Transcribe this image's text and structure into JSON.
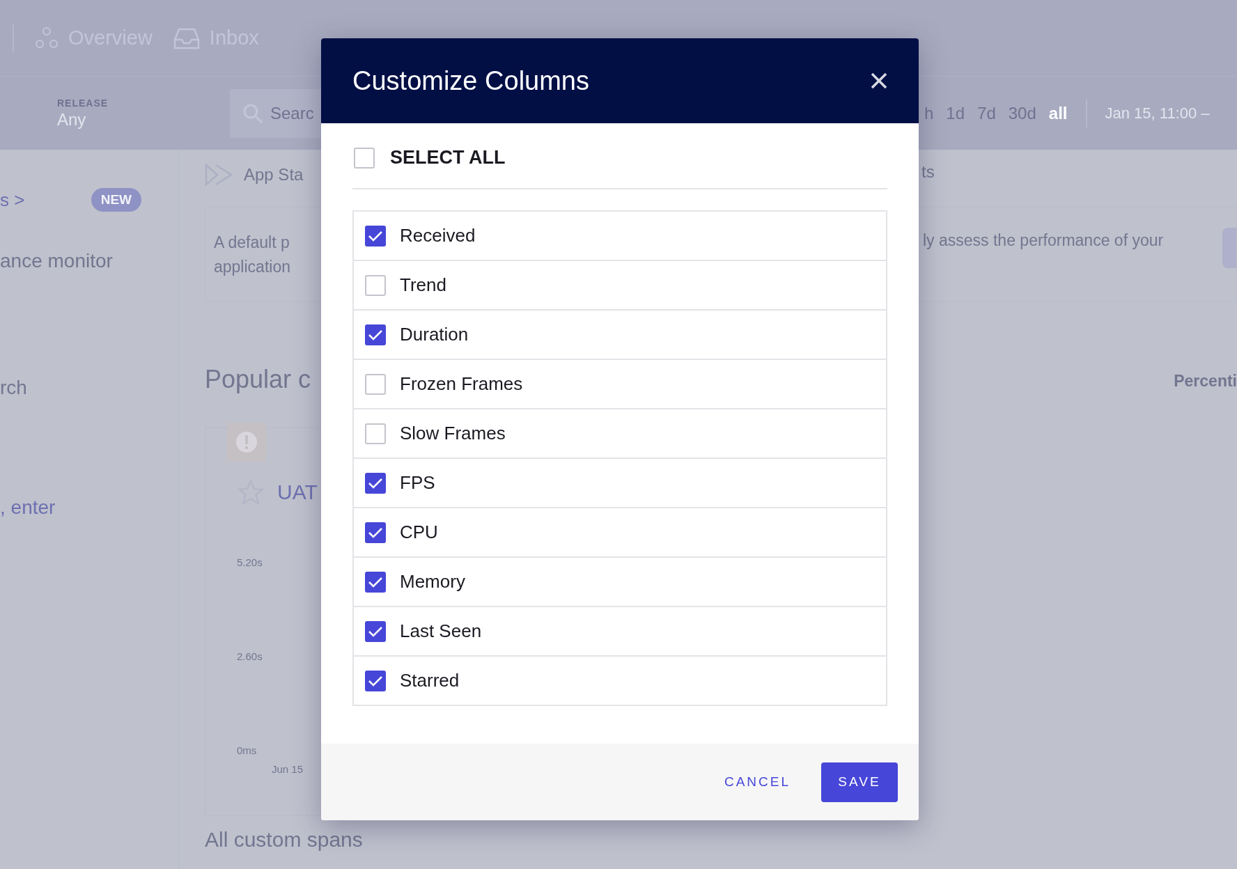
{
  "top_nav": {
    "items": [
      {
        "label": "Overview"
      },
      {
        "label": "Inbox"
      }
    ]
  },
  "filters": {
    "release_label": "RELEASE",
    "release_value": "Any",
    "search_placeholder": "Searc",
    "time_ranges": [
      {
        "label": "h",
        "selected": false
      },
      {
        "label": "1d",
        "selected": false
      },
      {
        "label": "7d",
        "selected": false
      },
      {
        "label": "30d",
        "selected": false
      },
      {
        "label": "all",
        "selected": true
      }
    ],
    "date_range": "Jan 15, 11:00 –"
  },
  "sidebar": {
    "link": "s >",
    "badge": "NEW",
    "title": "ance monitor",
    "hint_top": "rch",
    "hint_bottom": ", enter"
  },
  "main": {
    "section_tab": "App Sta",
    "section_tab_right": "ts",
    "description_left": [
      "A default p",
      "application"
    ],
    "description_right": "ly assess the performance of your",
    "popular_heading": "Popular c",
    "percentile_label": "Percenti",
    "card": {
      "title": "UAT",
      "starred": false,
      "y_labels": [
        "5.20s",
        "2.60s",
        "0ms"
      ],
      "x_label": "Jun 15"
    },
    "all_spans_heading": "All custom spans"
  },
  "dialog": {
    "title": "Customize Columns",
    "select_all": {
      "label": "SELECT ALL",
      "checked": false
    },
    "columns": [
      {
        "label": "Received",
        "checked": true
      },
      {
        "label": "Trend",
        "checked": false
      },
      {
        "label": "Duration",
        "checked": true
      },
      {
        "label": "Frozen Frames",
        "checked": false
      },
      {
        "label": "Slow Frames",
        "checked": false
      },
      {
        "label": "FPS",
        "checked": true
      },
      {
        "label": "CPU",
        "checked": true
      },
      {
        "label": "Memory",
        "checked": true
      },
      {
        "label": "Last Seen",
        "checked": true
      },
      {
        "label": "Starred",
        "checked": true
      }
    ],
    "cancel": "CANCEL",
    "save": "SAVE"
  }
}
